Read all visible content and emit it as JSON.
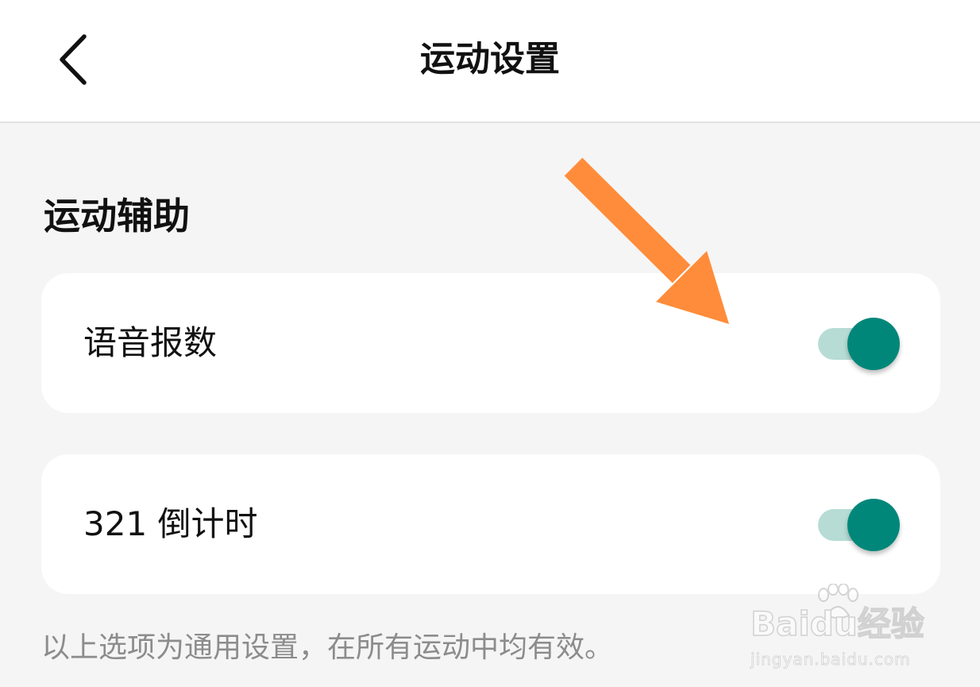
{
  "header": {
    "title": "运动设置",
    "back_icon": "chevron-left-icon"
  },
  "section": {
    "title": "运动辅助"
  },
  "settings": [
    {
      "label": "语音报数",
      "enabled": true
    },
    {
      "label": "321 倒计时",
      "enabled": true
    }
  ],
  "footnote": "以上选项为通用设置，在所有运动中均有效。",
  "annotation": {
    "icon": "arrow-icon",
    "color": "#ff8c3a"
  },
  "watermark": {
    "logo": "Baidu经验",
    "site": "jingyan.baidu.com"
  },
  "colors": {
    "toggle_on": "#00877a",
    "toggle_track": "#b6dcd5",
    "background": "#f5f5f5",
    "card": "#ffffff"
  }
}
